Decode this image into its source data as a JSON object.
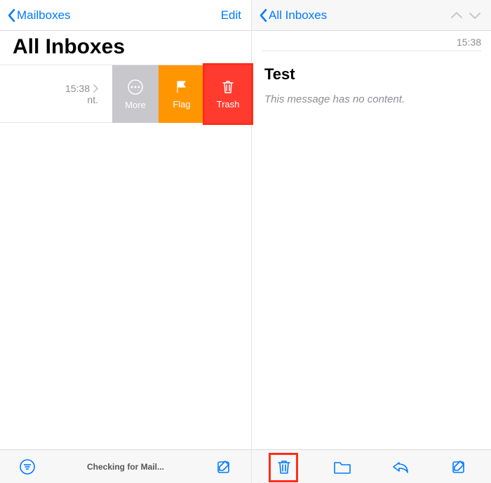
{
  "left": {
    "nav": {
      "back": "Mailboxes",
      "edit": "Edit"
    },
    "title": "All Inboxes",
    "row": {
      "time": "15:38",
      "snippet": "nt."
    },
    "actions": {
      "more": "More",
      "flag": "Flag",
      "trash": "Trash"
    },
    "toolbar": {
      "status": "Checking for Mail..."
    }
  },
  "right": {
    "nav": {
      "back": "All Inboxes"
    },
    "timestamp": "15:38",
    "message": {
      "subject": "Test",
      "body": "This message has no content."
    }
  }
}
